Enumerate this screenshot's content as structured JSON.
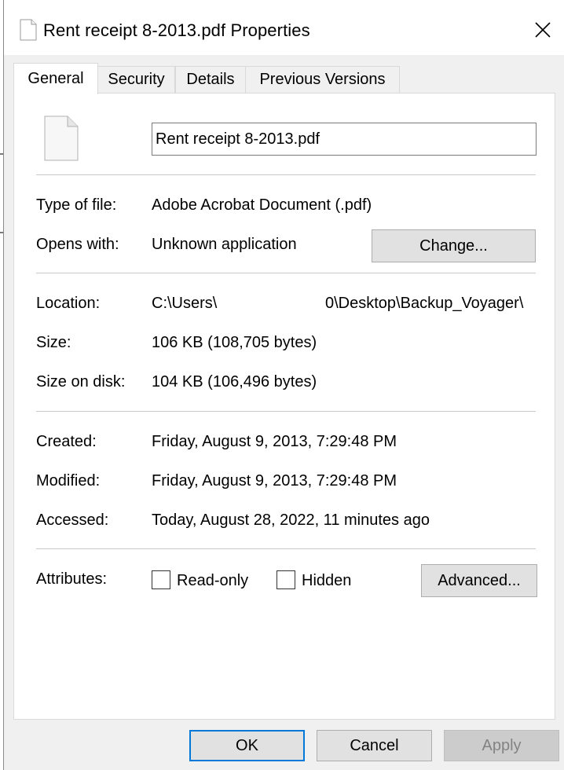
{
  "window": {
    "title": "Rent receipt 8-2013.pdf Properties"
  },
  "tabs": [
    "General",
    "Security",
    "Details",
    "Previous Versions"
  ],
  "general": {
    "filename": "Rent receipt 8-2013.pdf",
    "type_label": "Type of file:",
    "type_value": "Adobe Acrobat Document (.pdf)",
    "opens_label": "Opens with:",
    "opens_value": "Unknown application",
    "change_button": "Change...",
    "location_label": "Location:",
    "location_value_start": "C:\\Users\\",
    "location_value_end": "0\\Desktop\\Backup_Voyager\\",
    "size_label": "Size:",
    "size_value": "106 KB (108,705 bytes)",
    "sizeondisk_label": "Size on disk:",
    "sizeondisk_value": "104 KB (106,496 bytes)",
    "created_label": "Created:",
    "created_value": "Friday, August 9, 2013, 7:29:48 PM",
    "modified_label": "Modified:",
    "modified_value": "Friday, August 9, 2013, 7:29:48 PM",
    "accessed_label": "Accessed:",
    "accessed_value": "Today, August 28, 2022, 11 minutes ago",
    "attributes_label": "Attributes:",
    "readonly_label": "Read-only",
    "hidden_label": "Hidden",
    "advanced_button": "Advanced..."
  },
  "footer": {
    "ok": "OK",
    "cancel": "Cancel",
    "apply": "Apply"
  },
  "colors": {
    "dialog_bg": "#f0f0f0",
    "panel_bg": "#ffffff",
    "default_button_border": "#0078d7",
    "disabled_text": "#838383"
  }
}
